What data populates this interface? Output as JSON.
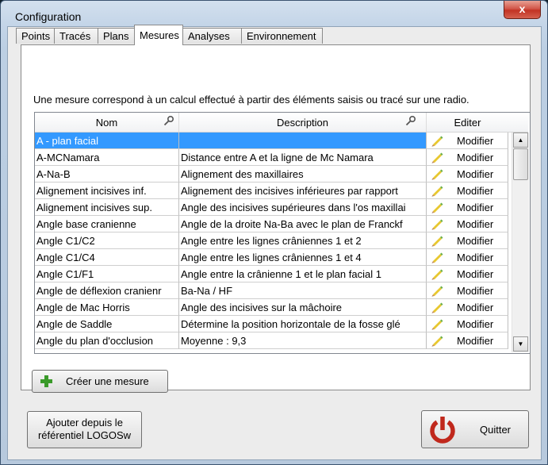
{
  "window": {
    "title": "Configuration",
    "close_glyph": "x"
  },
  "tabs": [
    "Points",
    "Tracés",
    "Plans",
    "Mesures",
    "Analyses",
    "Environnement"
  ],
  "active_tab": "Mesures",
  "intro": "Une mesure correspond à un calcul effectué à partir des éléments saisis ou tracé sur une radio.",
  "grid": {
    "headers": {
      "name": "Nom",
      "description": "Description",
      "edit": "Editer"
    },
    "rows": [
      {
        "name": "A - plan facial",
        "description": "",
        "action": "Modifier",
        "selected": true
      },
      {
        "name": "A-MCNamara",
        "description": "Distance entre A et la ligne de Mc Namara",
        "action": "Modifier"
      },
      {
        "name": "A-Na-B",
        "description": "Alignement des maxillaires",
        "action": "Modifier"
      },
      {
        "name": "Alignement incisives inf.",
        "description": "Alignement des incisives inférieures par rapport",
        "action": "Modifier"
      },
      {
        "name": "Alignement incisives sup.",
        "description": "Angle des incisives supérieures dans l'os maxillai",
        "action": "Modifier"
      },
      {
        "name": "Angle base cranienne",
        "description": "Angle de la droite Na-Ba avec le plan de Franckf",
        "action": "Modifier"
      },
      {
        "name": "Angle C1/C2",
        "description": "Angle entre les lignes crâniennes 1 et 2",
        "action": "Modifier"
      },
      {
        "name": "Angle C1/C4",
        "description": "Angle entre les lignes crâniennes 1 et 4",
        "action": "Modifier"
      },
      {
        "name": "Angle C1/F1",
        "description": "Angle entre la crânienne 1 et le plan facial 1",
        "action": "Modifier"
      },
      {
        "name": "Angle de déflexion cranienr",
        "description": "Ba-Na / HF",
        "action": "Modifier"
      },
      {
        "name": "Angle de Mac Horris",
        "description": "Angle des incisives sur la mâchoire",
        "action": "Modifier"
      },
      {
        "name": "Angle de Saddle",
        "description": "Détermine la position horizontale de la fosse glé",
        "action": "Modifier"
      },
      {
        "name": "Angle du plan d'occlusion",
        "description": "Moyenne : 9,3",
        "action": "Modifier"
      }
    ]
  },
  "buttons": {
    "create": "Créer une mesure",
    "add_line1": "Ajouter depuis le",
    "add_line2": "référentiel LOGOSw",
    "quit": "Quitter"
  },
  "colors": {
    "selection": "#3399ff",
    "plus": "#3a9a2a",
    "power": "#c0281c"
  },
  "icons": [
    "search-icon",
    "pencil-icon",
    "plus-icon",
    "power-icon",
    "close-icon"
  ]
}
